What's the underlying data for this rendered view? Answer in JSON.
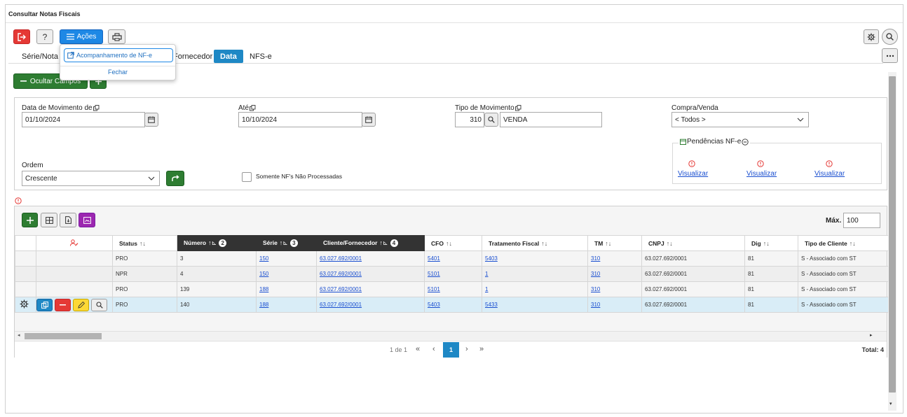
{
  "window": {
    "title": "Consultar Notas Fiscais"
  },
  "toolbar": {
    "acoes_label": "Ações"
  },
  "dropdown": {
    "item1": "Acompanhamento de NF-e",
    "close": "Fechar"
  },
  "tabs": [
    {
      "label": "Série/Nota Fi",
      "active": false
    },
    {
      "label": "Fornecedor",
      "active": false
    },
    {
      "label": "Data",
      "active": true
    },
    {
      "label": "NFS-e",
      "active": false
    }
  ],
  "hide_fields_label": "Ocultar Campos",
  "form": {
    "data_de_label": "Data de Movimento de",
    "data_de_value": "01/10/2024",
    "ate_label": "Até",
    "ate_value": "10/10/2024",
    "tipo_mov_label": "Tipo de Movimento",
    "tipo_mov_code": "310",
    "tipo_mov_desc": "VENDA",
    "compra_venda_label": "Compra/Venda",
    "compra_venda_value": "< Todos >",
    "ordem_label": "Ordem",
    "ordem_value": "Crescente",
    "somente_label": "Somente NF's Não Processadas",
    "pendencias_label": "Pendências NF-e",
    "visualizar": [
      "Visualizar",
      "Visualizar",
      "Visualizar"
    ]
  },
  "grid": {
    "max_label": "Máx.",
    "max_value": "100",
    "columns": [
      "Status",
      "Número",
      "Série",
      "Cliente/Fornecedor",
      "CFO",
      "Tratamento Fiscal",
      "TM",
      "CNPJ",
      "Dig",
      "Tipo de Cliente"
    ],
    "sort_badges": [
      "2",
      "3",
      "4"
    ],
    "rows": [
      [
        "PRO",
        "3",
        "150",
        "63.027.692/0001",
        "5401",
        "5403",
        "310",
        "63.027.692/0001",
        "81",
        "S - Associado com ST"
      ],
      [
        "NPR",
        "4",
        "150",
        "63.027.692/0001",
        "5101",
        "1",
        "310",
        "63.027.692/0001",
        "81",
        "S - Associado com ST"
      ],
      [
        "PRO",
        "139",
        "188",
        "63.027.692/0001",
        "5101",
        "1",
        "310",
        "63.027.692/0001",
        "81",
        "S - Associado com ST"
      ],
      [
        "PRO",
        "140",
        "188",
        "63.027.692/0001",
        "5403",
        "5433",
        "310",
        "63.027.692/0001",
        "81",
        "S - Associado com ST"
      ]
    ]
  },
  "pagination": {
    "info": "1 de 1",
    "first": "«",
    "prev": "‹",
    "current": "1",
    "next": "›",
    "last": "»",
    "total_label": "Total: 4"
  },
  "colors": {
    "accent": "#1e88c5",
    "danger": "#e53935",
    "success": "#2e7d32",
    "purple": "#9c27b0"
  }
}
